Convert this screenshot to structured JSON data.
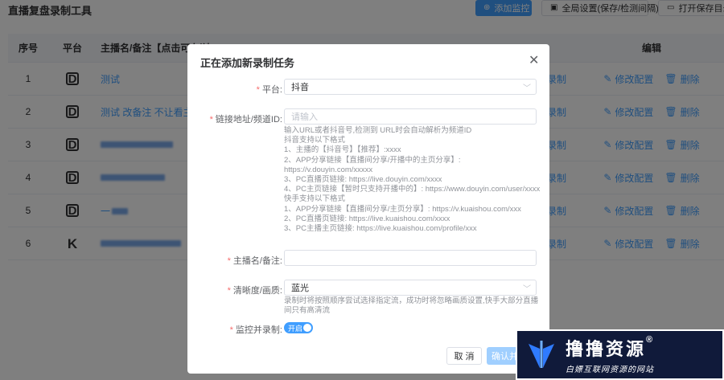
{
  "app_title": "直播复盘录制工具",
  "toolbar": {
    "add_label": "添加监控",
    "settings_label": "全局设置(保存/检测间隔)",
    "open_dir_label": "打开保存目录"
  },
  "table": {
    "headers": {
      "index": "序号",
      "platform": "平台",
      "name": "主播名/备注【点击可在浏",
      "edit": "编辑"
    },
    "record_label": "录制",
    "edit_label": "修改配置",
    "delete_label": "删除",
    "rows": [
      {
        "index": "1",
        "platform": "D",
        "name": "测试"
      },
      {
        "index": "2",
        "platform": "D",
        "name": "测试 改备注 不让看主播名"
      },
      {
        "index": "3",
        "platform": "D",
        "name": ""
      },
      {
        "index": "4",
        "platform": "D",
        "name": ""
      },
      {
        "index": "5",
        "platform": "D",
        "name": "一"
      },
      {
        "index": "6",
        "platform": "K",
        "name": ""
      }
    ]
  },
  "dialog": {
    "title": "正在添加新录制任务",
    "platform": {
      "label": "平台:",
      "value": "抖音"
    },
    "url": {
      "label": "链接地址/频道ID:",
      "placeholder": "请输入",
      "help": [
        "输入URL或者抖音号,检测到 URL时会自动解析为频道ID",
        "抖音支持以下格式",
        "1、主播的【抖音号】【推荐】:xxxx",
        "2、APP分享链接【直播间分享/开播中的主页分享】:",
        "https://v.douyin.com/xxxxx",
        "3、PC直播页链接: https://live.douyin.com/xxxx",
        "4、PC主页链接【暂时只支持开播中的】: https://www.douyin.com/user/xxxx",
        "快手支持以下格式",
        "1、APP分享链接【直播间分享/主页分享】: https://v.kuaishou.com/xxx",
        "2、PC直播页链接: https://live.kuaishou.com/xxxx",
        "3、PC主播主页链接: https://live.kuaishou.com/profile/xxx"
      ]
    },
    "name": {
      "label": "主播名/备注:",
      "value": ""
    },
    "quality": {
      "label": "清晰度/画质:",
      "value": "蓝光",
      "help": [
        "录制时将按照顺序尝试选择指定流，成功时将忽略画质设置,快手大部分直播",
        "间只有高清流"
      ]
    },
    "monitor": {
      "label": "监控并录制:",
      "toggle_text": "开启"
    },
    "cancel_label": "取 消",
    "confirm_label": "确认并"
  },
  "watermark": {
    "main": "撸撸资源",
    "reg": "®",
    "sub": "白嫖互联网资源的网站"
  },
  "colors": {
    "primary": "#409eff",
    "required": "#f56c6c"
  }
}
